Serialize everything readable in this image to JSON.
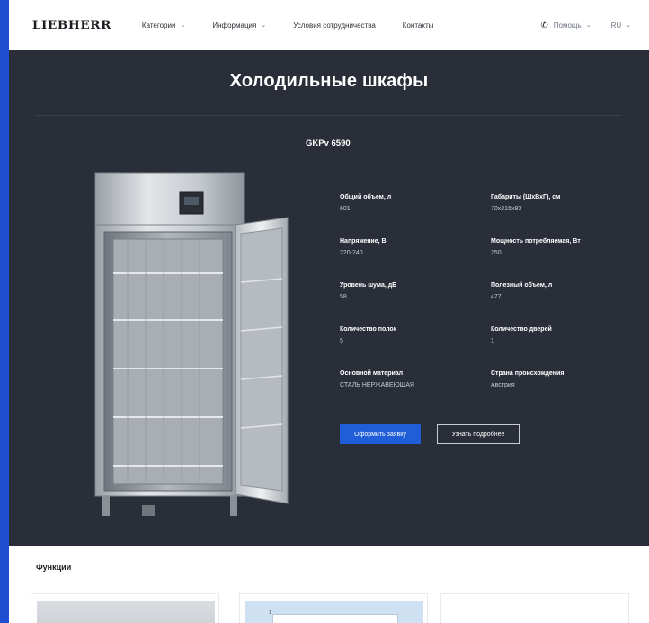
{
  "header": {
    "logo": "LIEBHERR",
    "nav": [
      {
        "label": "Категории",
        "has_dropdown": true
      },
      {
        "label": "Информация",
        "has_dropdown": true
      },
      {
        "label": "Условия сотрудничества",
        "has_dropdown": false
      },
      {
        "label": "Контакты",
        "has_dropdown": false
      }
    ],
    "help_label": "Помощь",
    "lang_label": "RU"
  },
  "hero": {
    "title": "Холодильные шкафы",
    "model": "GKPv 6590",
    "specs": [
      {
        "label": "Общий объем, л",
        "value": "601"
      },
      {
        "label": "Габариты (ШхВхГ), см",
        "value": "70x215x83"
      },
      {
        "label": "Напряжение, В",
        "value": "220-240"
      },
      {
        "label": "Мощность потребляемая, Вт",
        "value": "250"
      },
      {
        "label": "Уровень шума, дБ",
        "value": "58"
      },
      {
        "label": "Полезный объем, л",
        "value": "477"
      },
      {
        "label": "Количество полок",
        "value": "5"
      },
      {
        "label": "Количество дверей",
        "value": "1"
      },
      {
        "label": "Основной материал",
        "value": "СТАЛЬ НЕРЖАВЕЮЩАЯ"
      },
      {
        "label": "Страна происхождения",
        "value": "Австрия"
      }
    ],
    "primary_button": "Оформить заявку",
    "secondary_button": "Узнать подробнее"
  },
  "functions": {
    "title": "Функции",
    "card2_marker": "1"
  },
  "colors": {
    "accent": "#1f5ed8",
    "hero_bg": "#2a2e39",
    "page_frame": "#1f4fd0"
  }
}
